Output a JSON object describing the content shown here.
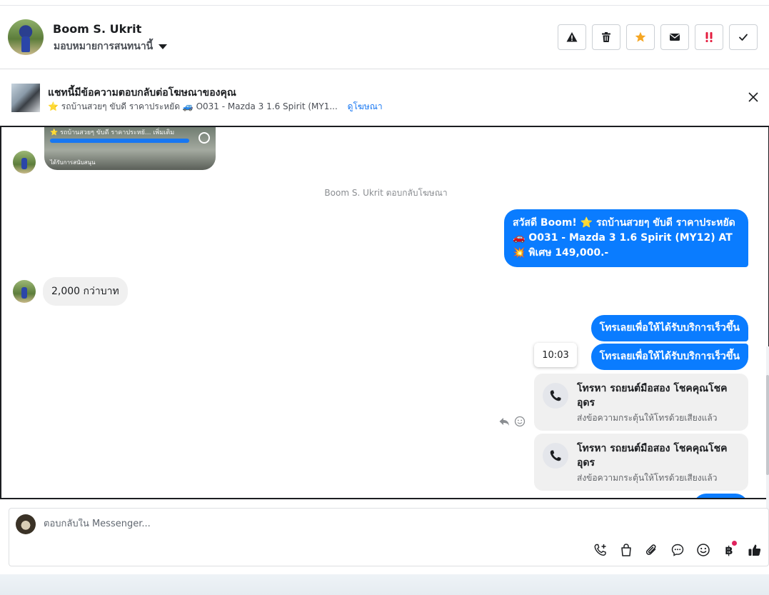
{
  "header": {
    "contact_name": "Boom S. Ukrit",
    "assign_label": "มอบหมายการสนทนานี้",
    "actions": [
      {
        "name": "warning-icon",
        "color": "#1c1e21"
      },
      {
        "name": "trash-icon",
        "color": "#1c1e21"
      },
      {
        "name": "star-icon",
        "color": "#f5a623"
      },
      {
        "name": "envelope-icon",
        "color": "#1c1e21"
      },
      {
        "name": "important-icon",
        "color": "#e41e3f"
      },
      {
        "name": "check-icon",
        "color": "#1c1e21"
      }
    ]
  },
  "ad_banner": {
    "title": "แชทนี้มีข้อความตอบกลับต่อโฆษณาของคุณ",
    "subtitle": "⭐ รถบ้านสวยๆ ขับดี ราคาประหยัด 🚙 O031 - Mazda 3 1.6 Spirit (MY1...",
    "link": "ดูโฆษณา"
  },
  "chat": {
    "ad_preview_text": "⭐ รถบ้านสวยๆ ขับดี ราคาประหยั... เพิ่มเติม",
    "ad_preview_footer": "ได้รับการสนับสนุน",
    "system_note": "Boom S. Ukrit ตอบกลับโฆษณา",
    "outgoing_1": {
      "line1": "สวัสดี Boom! ⭐ รถบ้านสวยๆ ขับดี ราคาประหยัด",
      "line2": "🚗 O031 - Mazda 3 1.6 Spirit (MY12) AT",
      "line3": "💥 พิเศษ 149,000.-"
    },
    "incoming_1": "2,000 กว่าบาท",
    "outgoing_2": "โทรเลยเพื่อให้ได้รับบริการเร็วขึ้น",
    "outgoing_3": "โทรเลยเพื่อให้ได้รับบริการเร็วขึ้น",
    "timestamp": "10:03",
    "call_cards": [
      {
        "title": "โทรหา รถยนต์มือสอง โชคคุณโชค อุดร",
        "subtitle": "ส่งข้อความกระตุ้นให้โทรด้วยเสียงแล้ว"
      },
      {
        "title": "โทรหา รถยนต์มือสอง โชคคุณโชค อุดร",
        "subtitle": "ส่งข้อความกระตุ้นให้โทรด้วยเสียงแล้ว"
      }
    ]
  },
  "composer": {
    "placeholder": "ตอบกลับใน Messenger...",
    "value": "",
    "tools": [
      "phone-plus-icon",
      "shopping-bag-icon",
      "paperclip-icon",
      "chat-bubble-icon",
      "emoji-icon",
      "baht-icon",
      "thumbs-up-icon"
    ],
    "baht_symbol": "฿"
  },
  "colors": {
    "brand_blue": "#0a7cff",
    "link_blue": "#1877f2",
    "incoming_bg": "#f0f0f0"
  }
}
